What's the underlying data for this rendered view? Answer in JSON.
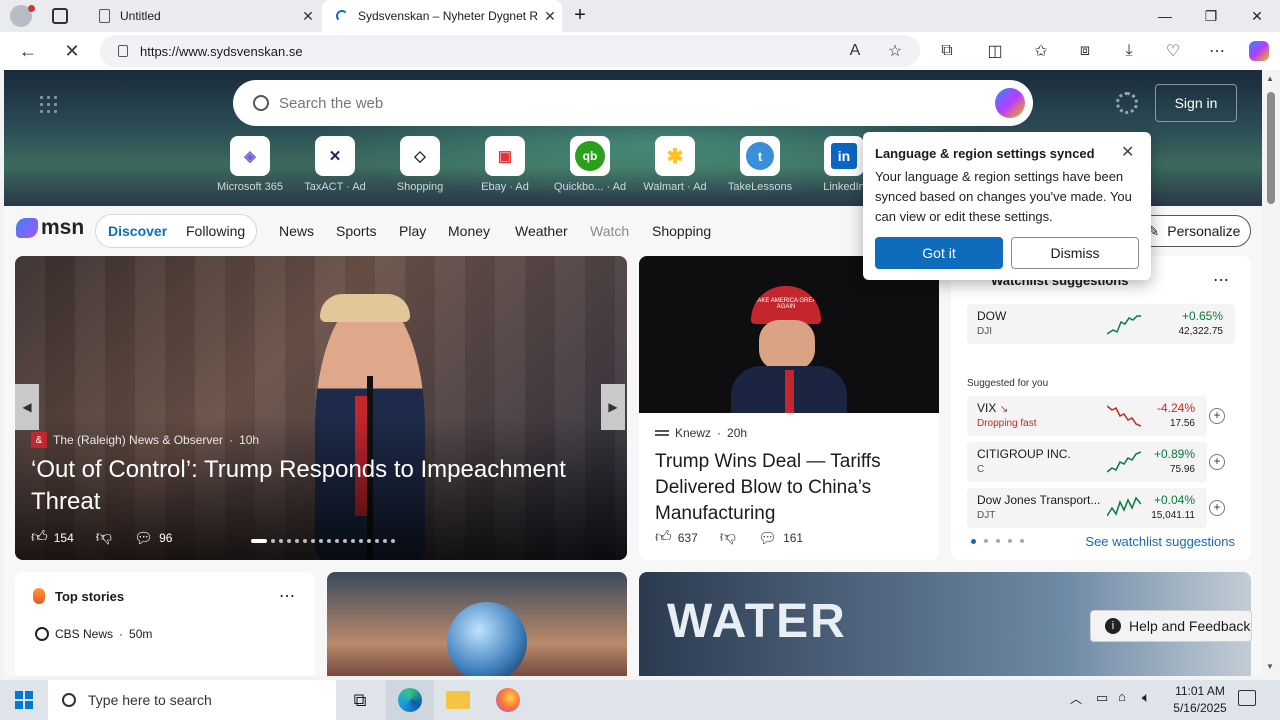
{
  "tabs": [
    {
      "title": "Untitled"
    },
    {
      "title": "Sydsvenskan – Nyheter Dygnet R"
    }
  ],
  "address": {
    "url": "https://www.sydsvenskan.se"
  },
  "search": {
    "placeholder": "Search the web"
  },
  "header": {
    "sign_in": "Sign in"
  },
  "quick_links": [
    {
      "label": "Microsoft 365",
      "ad": "",
      "color": "#7b5cd6",
      "glyph": "◈"
    },
    {
      "label": "TaxACT",
      "ad": "· Ad",
      "color": "#1a2a4f",
      "glyph": "✕"
    },
    {
      "label": "Shopping",
      "ad": "",
      "color": "#333333",
      "glyph": "◇"
    },
    {
      "label": "Ebay",
      "ad": "· Ad",
      "color": "#e53238",
      "glyph": "▣"
    },
    {
      "label": "Quickbo...",
      "ad": "· Ad",
      "color": "#2ca01c",
      "glyph": "qb"
    },
    {
      "label": "Walmart",
      "ad": "· Ad",
      "color": "#0071ce",
      "glyph": "✱"
    },
    {
      "label": "TakeLessons",
      "ad": "",
      "color": "#3a8fd9",
      "glyph": "t"
    },
    {
      "label": "LinkedIn",
      "ad": "",
      "color": "#0a66c2",
      "glyph": "in"
    }
  ],
  "msn": {
    "logo": "msn",
    "tabs": [
      {
        "label": "Discover"
      },
      {
        "label": "Following"
      }
    ],
    "links": [
      {
        "label": "News"
      },
      {
        "label": "Sports"
      },
      {
        "label": "Play"
      },
      {
        "label": "Money"
      },
      {
        "label": "Weather"
      },
      {
        "label": "Watch"
      },
      {
        "label": "Shopping"
      }
    ],
    "personalize": "Personalize"
  },
  "hero": {
    "source": "The (Raleigh) News & Observer",
    "age": "10h",
    "title": "‘Out of Control’: Trump Responds to Impeachment Threat",
    "likes": "154",
    "comments": "96"
  },
  "card2": {
    "source": "Knewz",
    "age": "20h",
    "title": "Trump Wins Deal — Tariffs Delivered Blow to China’s Manufacturing",
    "likes": "637",
    "comments": "161",
    "cap_text": "MAKE AMERICA GREAT AGAIN"
  },
  "watchlist": {
    "title": "Watchlist suggestions",
    "suggested_label": "Suggested for you",
    "see_link": "See watchlist suggestions",
    "stocks": [
      {
        "name": "DOW",
        "sub": "DJI",
        "change": "+0.65%",
        "price": "42,322.75",
        "color": "#0b7a3e"
      },
      {
        "name": "VIX",
        "sub": "Dropping fast",
        "change": "-4.24%",
        "price": "17.56",
        "color": "#c42b1c"
      },
      {
        "name": "CITIGROUP INC.",
        "sub": "C",
        "change": "+0.89%",
        "price": "75.96",
        "color": "#0b7a3e"
      },
      {
        "name": "Dow Jones Transport...",
        "sub": "DJT",
        "change": "+0.04%",
        "price": "15,041.11",
        "color": "#0b7a3e"
      }
    ]
  },
  "popup": {
    "title": "Language & region settings synced",
    "body": "Your language & region settings have been synced based on changes you've made. You can view or edit these settings.",
    "primary": "Got it",
    "secondary": "Dismiss"
  },
  "topstories": {
    "title": "Top stories",
    "source": "CBS News",
    "age": "50m"
  },
  "card5": {
    "text": "WATER"
  },
  "help": {
    "label": "Help and Feedback"
  },
  "taskbar": {
    "search_placeholder": "Type here to search",
    "time": "11:01 AM",
    "date": "5/16/2025"
  },
  "colors": {
    "accent": "#0f6cbd",
    "edge_blue": "#0078d4"
  }
}
